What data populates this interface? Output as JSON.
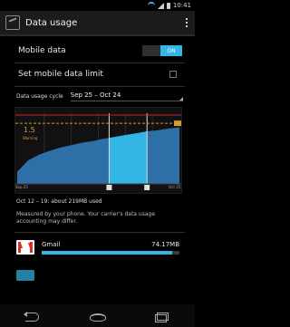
{
  "status_bar": {
    "time": "10:41",
    "icons": [
      "wifi-icon",
      "signal-icon",
      "battery-icon"
    ]
  },
  "action_bar": {
    "title": "Data usage",
    "icon": "data-usage-icon"
  },
  "settings": {
    "mobile_data_label": "Mobile data",
    "mobile_data_toggle": "ON",
    "limit_label": "Set mobile data limit"
  },
  "cycle": {
    "label": "Data usage cycle",
    "value": "Sep 25 – Oct 24"
  },
  "chart": {
    "warning_value": "1.5",
    "warning_label": "Warning",
    "x_start": "Sep 25",
    "x_end": "Oct 25"
  },
  "chart_data": {
    "type": "area",
    "title": "",
    "xlabel": "",
    "ylabel": "",
    "x": [
      0,
      2,
      4,
      6,
      8,
      10,
      12,
      14,
      16,
      18,
      20,
      22,
      24,
      26,
      28,
      30
    ],
    "values": [
      0.3,
      0.58,
      0.72,
      0.82,
      0.9,
      0.96,
      1.02,
      1.06,
      1.12,
      1.16,
      1.21,
      1.25,
      1.3,
      1.33,
      1.37,
      1.4
    ],
    "x_tick_labels": [
      "Sep 25",
      "Oct 25"
    ],
    "warning_line": 1.5,
    "selected_range": [
      "Oct 12",
      "Oct 19"
    ],
    "colors": {
      "area": "#2d6fa6",
      "selected_area": "#33b5e5",
      "warning": "#d69c2b",
      "limit": "#cc2222"
    }
  },
  "summary": "Oct 12 – 19: about 219MB used",
  "note": "Measured by your phone. Your carrier's data usage accounting may differ.",
  "apps": [
    {
      "name": "Gmail",
      "usage": "74.17MB",
      "icon": "gmail-icon"
    }
  ],
  "navigation": {
    "back": "back-icon",
    "home": "home-icon",
    "recents": "recents-icon"
  },
  "accent_color": "#33b5e5"
}
